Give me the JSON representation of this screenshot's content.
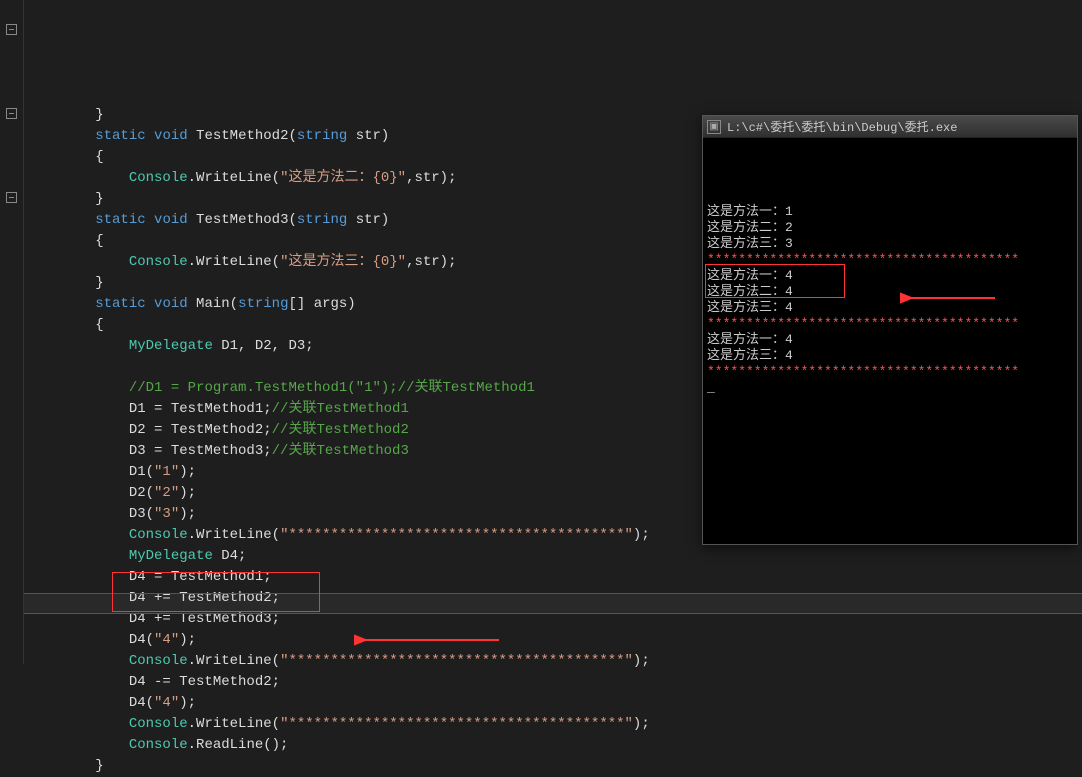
{
  "console": {
    "title": "L:\\c#\\委托\\委托\\bin\\Debug\\委托.exe",
    "lines": [
      {
        "text": "这是方法一：1",
        "cls": ""
      },
      {
        "text": "这是方法二：2",
        "cls": ""
      },
      {
        "text": "这是方法三：3",
        "cls": ""
      },
      {
        "text": "****************************************",
        "cls": "asterisks"
      },
      {
        "text": "这是方法一：4",
        "cls": ""
      },
      {
        "text": "这是方法二：4",
        "cls": ""
      },
      {
        "text": "这是方法三：4",
        "cls": ""
      },
      {
        "text": "****************************************",
        "cls": "asterisks"
      },
      {
        "text": "这是方法一：4",
        "cls": ""
      },
      {
        "text": "这是方法三：4",
        "cls": ""
      },
      {
        "text": "****************************************",
        "cls": "asterisks"
      },
      {
        "text": "_",
        "cls": ""
      }
    ]
  },
  "code": {
    "lines": [
      [
        {
          "t": "        }",
          "c": "brk"
        }
      ],
      [
        {
          "t": "        ",
          "c": ""
        },
        {
          "t": "static",
          "c": "kw"
        },
        {
          "t": " ",
          "c": ""
        },
        {
          "t": "void",
          "c": "kw"
        },
        {
          "t": " TestMethod2(",
          "c": "plain"
        },
        {
          "t": "string",
          "c": "kw"
        },
        {
          "t": " str)",
          "c": "plain"
        }
      ],
      [
        {
          "t": "        {",
          "c": "brk"
        }
      ],
      [
        {
          "t": "            ",
          "c": ""
        },
        {
          "t": "Console",
          "c": "cls"
        },
        {
          "t": ".WriteLine(",
          "c": "plain"
        },
        {
          "t": "\"这是方法二：{0}\"",
          "c": "str"
        },
        {
          "t": ",str);",
          "c": "plain"
        }
      ],
      [
        {
          "t": "        }",
          "c": "brk"
        }
      ],
      [
        {
          "t": "        ",
          "c": ""
        },
        {
          "t": "static",
          "c": "kw"
        },
        {
          "t": " ",
          "c": ""
        },
        {
          "t": "void",
          "c": "kw"
        },
        {
          "t": " TestMethod3(",
          "c": "plain"
        },
        {
          "t": "string",
          "c": "kw"
        },
        {
          "t": " str)",
          "c": "plain"
        }
      ],
      [
        {
          "t": "        {",
          "c": "brk"
        }
      ],
      [
        {
          "t": "            ",
          "c": ""
        },
        {
          "t": "Console",
          "c": "cls"
        },
        {
          "t": ".WriteLine(",
          "c": "plain"
        },
        {
          "t": "\"这是方法三：{0}\"",
          "c": "str"
        },
        {
          "t": ",str);",
          "c": "plain"
        }
      ],
      [
        {
          "t": "        }",
          "c": "brk"
        }
      ],
      [
        {
          "t": "        ",
          "c": ""
        },
        {
          "t": "static",
          "c": "kw"
        },
        {
          "t": " ",
          "c": ""
        },
        {
          "t": "void",
          "c": "kw"
        },
        {
          "t": " Main(",
          "c": "plain"
        },
        {
          "t": "string",
          "c": "kw"
        },
        {
          "t": "[] args)",
          "c": "plain"
        }
      ],
      [
        {
          "t": "        {",
          "c": "brk"
        }
      ],
      [
        {
          "t": "            ",
          "c": ""
        },
        {
          "t": "MyDelegate",
          "c": "cls"
        },
        {
          "t": " D1, D2, D3;",
          "c": "plain"
        }
      ],
      [
        {
          "t": "",
          "c": ""
        }
      ],
      [
        {
          "t": "            ",
          "c": ""
        },
        {
          "t": "//D1 = Program.TestMethod1(\"1\");//关联TestMethod1",
          "c": "cmt"
        }
      ],
      [
        {
          "t": "            D1 = TestMethod1;",
          "c": "plain"
        },
        {
          "t": "//关联TestMethod1",
          "c": "cmt"
        }
      ],
      [
        {
          "t": "            D2 = TestMethod2;",
          "c": "plain"
        },
        {
          "t": "//关联TestMethod2",
          "c": "cmt"
        }
      ],
      [
        {
          "t": "            D3 = TestMethod3;",
          "c": "plain"
        },
        {
          "t": "//关联TestMethod3",
          "c": "cmt"
        }
      ],
      [
        {
          "t": "            D1(",
          "c": "plain"
        },
        {
          "t": "\"1\"",
          "c": "str"
        },
        {
          "t": ");",
          "c": "plain"
        }
      ],
      [
        {
          "t": "            D2(",
          "c": "plain"
        },
        {
          "t": "\"2\"",
          "c": "str"
        },
        {
          "t": ");",
          "c": "plain"
        }
      ],
      [
        {
          "t": "            D3(",
          "c": "plain"
        },
        {
          "t": "\"3\"",
          "c": "str"
        },
        {
          "t": ");",
          "c": "plain"
        }
      ],
      [
        {
          "t": "            ",
          "c": ""
        },
        {
          "t": "Console",
          "c": "cls"
        },
        {
          "t": ".WriteLine(",
          "c": "plain"
        },
        {
          "t": "\"****************************************\"",
          "c": "str"
        },
        {
          "t": ");",
          "c": "plain"
        }
      ],
      [
        {
          "t": "            ",
          "c": ""
        },
        {
          "t": "MyDelegate",
          "c": "cls"
        },
        {
          "t": " D4;",
          "c": "plain"
        }
      ],
      [
        {
          "t": "            D4 = TestMethod1;",
          "c": "plain"
        }
      ],
      [
        {
          "t": "            D4 += TestMethod2;",
          "c": "plain"
        }
      ],
      [
        {
          "t": "            D4 += TestMethod3;",
          "c": "plain"
        }
      ],
      [
        {
          "t": "            D4(",
          "c": "plain"
        },
        {
          "t": "\"4\"",
          "c": "str"
        },
        {
          "t": ");",
          "c": "plain"
        }
      ],
      [
        {
          "t": "            ",
          "c": ""
        },
        {
          "t": "Console",
          "c": "cls"
        },
        {
          "t": ".WriteLine(",
          "c": "plain"
        },
        {
          "t": "\"****************************************\"",
          "c": "str"
        },
        {
          "t": ");",
          "c": "plain"
        }
      ],
      [
        {
          "t": "            D4 -= TestMethod2;",
          "c": "plain"
        }
      ],
      [
        {
          "t": "            D4(",
          "c": "plain"
        },
        {
          "t": "\"4\"",
          "c": "str"
        },
        {
          "t": ");",
          "c": "plain"
        }
      ],
      [
        {
          "t": "            ",
          "c": ""
        },
        {
          "t": "Console",
          "c": "cls"
        },
        {
          "t": ".WriteLine(",
          "c": "plain"
        },
        {
          "t": "\"****************************************\"",
          "c": "str"
        },
        {
          "t": ");",
          "c": "plain"
        }
      ],
      [
        {
          "t": "            ",
          "c": ""
        },
        {
          "t": "Console",
          "c": "cls"
        },
        {
          "t": ".ReadLine();",
          "c": "plain"
        }
      ],
      [
        {
          "t": "        }",
          "c": "brk"
        }
      ]
    ]
  }
}
